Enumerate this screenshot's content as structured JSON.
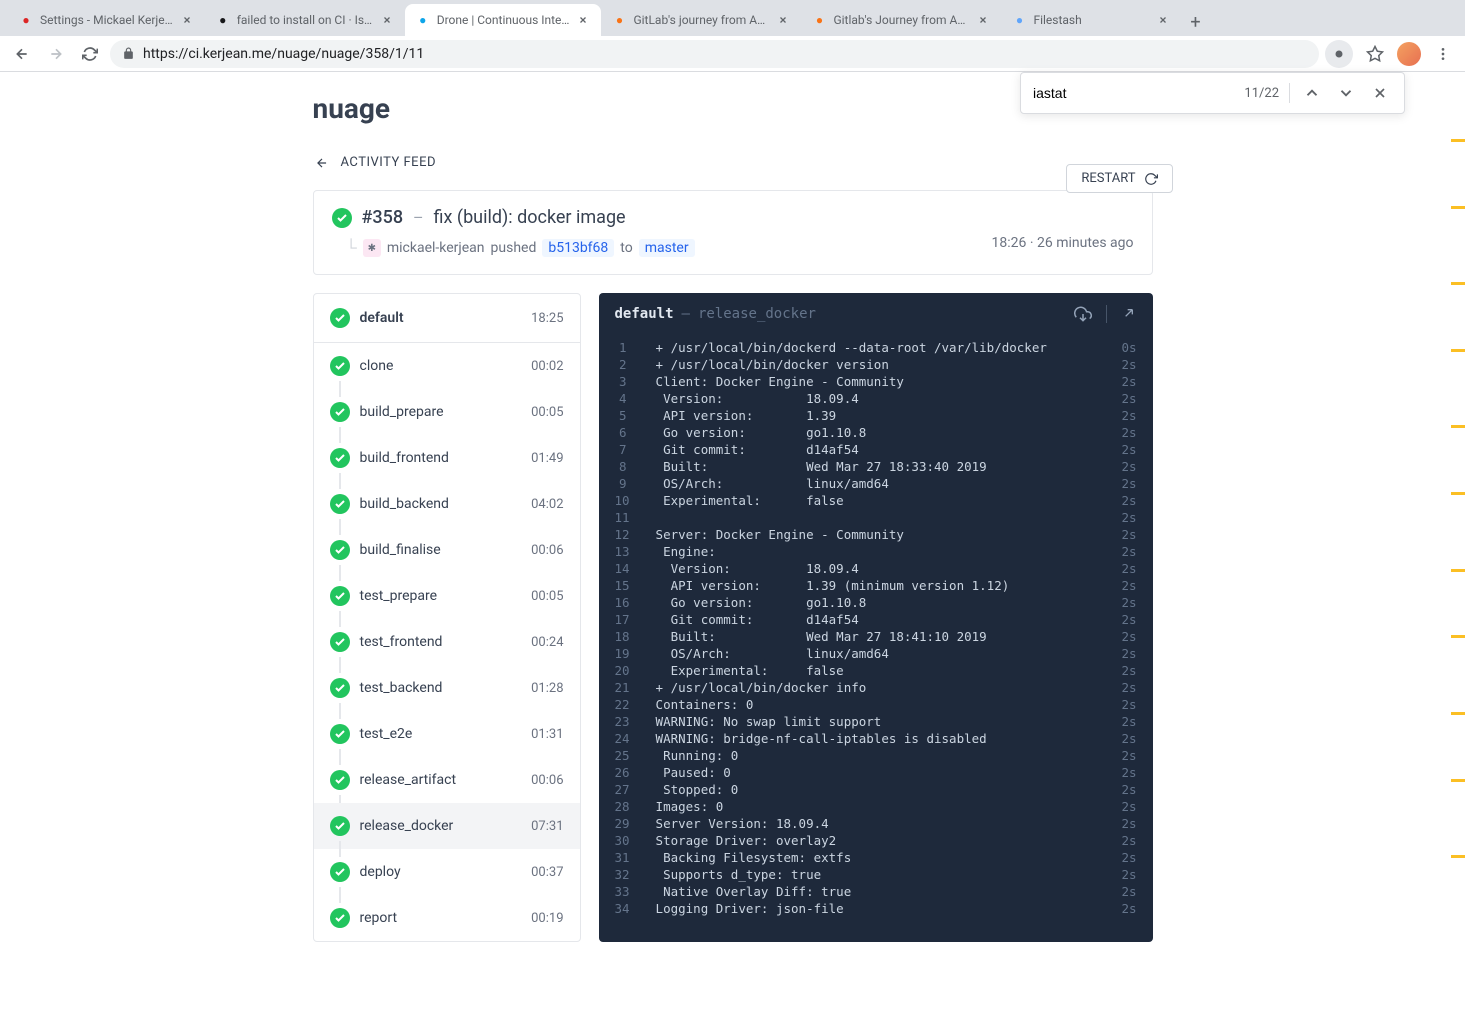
{
  "tabs": [
    {
      "title": "Settings - Mickael Kerje…",
      "favicon_color": "#dc2626"
    },
    {
      "title": "failed to install on CI · Iss…",
      "favicon_color": "#18181b"
    },
    {
      "title": "Drone | Continuous Inte…",
      "favicon_color": "#0ea5e9",
      "active": true
    },
    {
      "title": "GitLab's journey from Az…",
      "favicon_color": "#f97316"
    },
    {
      "title": "Gitlab's Journey from Az…",
      "favicon_color": "#f97316"
    },
    {
      "title": "Filestash",
      "favicon_color": "#60a5fa"
    }
  ],
  "url": "https://ci.kerjean.me/nuage/nuage/358/1/11",
  "find": {
    "query": "iastat",
    "count": "11/22"
  },
  "repo": {
    "title": "nuage",
    "activity_label": "ACTIVITY FEED"
  },
  "restart_label": "RESTART",
  "build": {
    "number": "#358",
    "title": "fix (build): docker image",
    "author": "mickael-kerjean",
    "action": "pushed",
    "commit": "b513bf68",
    "to_label": "to",
    "branch": "master",
    "time": "18:26",
    "relative": "26 minutes ago"
  },
  "pipeline": {
    "name": "default",
    "time": "18:25"
  },
  "steps": [
    {
      "name": "clone",
      "time": "00:02"
    },
    {
      "name": "build_prepare",
      "time": "00:05"
    },
    {
      "name": "build_frontend",
      "time": "01:49"
    },
    {
      "name": "build_backend",
      "time": "04:02"
    },
    {
      "name": "build_finalise",
      "time": "00:06"
    },
    {
      "name": "test_prepare",
      "time": "00:05"
    },
    {
      "name": "test_frontend",
      "time": "00:24"
    },
    {
      "name": "test_backend",
      "time": "01:28"
    },
    {
      "name": "test_e2e",
      "time": "01:31"
    },
    {
      "name": "release_artifact",
      "time": "00:06"
    },
    {
      "name": "release_docker",
      "time": "07:31",
      "selected": true
    },
    {
      "name": "deploy",
      "time": "00:37"
    },
    {
      "name": "report",
      "time": "00:19"
    }
  ],
  "console": {
    "title": "default",
    "subtitle": "release_docker",
    "lines": [
      {
        "n": 1,
        "t": "  + /usr/local/bin/dockerd --data-root /var/lib/docker",
        "d": "0s"
      },
      {
        "n": 2,
        "t": "  + /usr/local/bin/docker version",
        "d": "2s"
      },
      {
        "n": 3,
        "t": "  Client: Docker Engine - Community",
        "d": "2s"
      },
      {
        "n": 4,
        "t": "   Version:           18.09.4",
        "d": "2s"
      },
      {
        "n": 5,
        "t": "   API version:       1.39",
        "d": "2s"
      },
      {
        "n": 6,
        "t": "   Go version:        go1.10.8",
        "d": "2s"
      },
      {
        "n": 7,
        "t": "   Git commit:        d14af54",
        "d": "2s"
      },
      {
        "n": 8,
        "t": "   Built:             Wed Mar 27 18:33:40 2019",
        "d": "2s"
      },
      {
        "n": 9,
        "t": "   OS/Arch:           linux/amd64",
        "d": "2s"
      },
      {
        "n": 10,
        "t": "   Experimental:      false",
        "d": "2s"
      },
      {
        "n": 11,
        "t": "  ",
        "d": "2s"
      },
      {
        "n": 12,
        "t": "  Server: Docker Engine - Community",
        "d": "2s"
      },
      {
        "n": 13,
        "t": "   Engine:",
        "d": "2s"
      },
      {
        "n": 14,
        "t": "    Version:          18.09.4",
        "d": "2s"
      },
      {
        "n": 15,
        "t": "    API version:      1.39 (minimum version 1.12)",
        "d": "2s"
      },
      {
        "n": 16,
        "t": "    Go version:       go1.10.8",
        "d": "2s"
      },
      {
        "n": 17,
        "t": "    Git commit:       d14af54",
        "d": "2s"
      },
      {
        "n": 18,
        "t": "    Built:            Wed Mar 27 18:41:10 2019",
        "d": "2s"
      },
      {
        "n": 19,
        "t": "    OS/Arch:          linux/amd64",
        "d": "2s"
      },
      {
        "n": 20,
        "t": "    Experimental:     false",
        "d": "2s"
      },
      {
        "n": 21,
        "t": "  + /usr/local/bin/docker info",
        "d": "2s"
      },
      {
        "n": 22,
        "t": "  Containers: 0",
        "d": "2s"
      },
      {
        "n": 23,
        "t": "  WARNING: No swap limit support",
        "d": "2s"
      },
      {
        "n": 24,
        "t": "  WARNING: bridge-nf-call-iptables is disabled",
        "d": "2s"
      },
      {
        "n": 25,
        "t": "   Running: 0",
        "d": "2s"
      },
      {
        "n": 26,
        "t": "   Paused: 0",
        "d": "2s"
      },
      {
        "n": 27,
        "t": "   Stopped: 0",
        "d": "2s"
      },
      {
        "n": 28,
        "t": "  Images: 0",
        "d": "2s"
      },
      {
        "n": 29,
        "t": "  Server Version: 18.09.4",
        "d": "2s"
      },
      {
        "n": 30,
        "t": "  Storage Driver: overlay2",
        "d": "2s"
      },
      {
        "n": 31,
        "t": "   Backing Filesystem: extfs",
        "d": "2s"
      },
      {
        "n": 32,
        "t": "   Supports d_type: true",
        "d": "2s"
      },
      {
        "n": 33,
        "t": "   Native Overlay Diff: true",
        "d": "2s"
      },
      {
        "n": 34,
        "t": "  Logging Driver: json-file",
        "d": "2s"
      }
    ]
  },
  "scroll_marks": [
    7,
    14,
    22,
    29,
    37,
    44,
    52,
    59,
    67,
    74,
    82
  ]
}
